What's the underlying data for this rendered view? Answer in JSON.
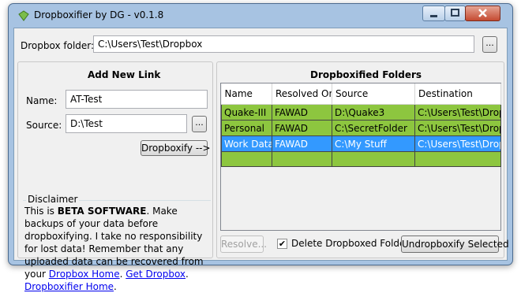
{
  "window": {
    "title": "Dropboxifier by DG - v0.1.8",
    "minimize": "–",
    "maximize": "▢",
    "close": "✕"
  },
  "folder": {
    "label": "Dropbox folder:",
    "value": "C:\\Users\\Test\\Dropbox",
    "browse": "..."
  },
  "add_link": {
    "title": "Add New Link",
    "name_label": "Name:",
    "name_value": "AT-Test",
    "source_label": "Source:",
    "source_value": "D:\\Test",
    "browse": "...",
    "dropboxify": "Dropboxify -->"
  },
  "disclaimer": {
    "legend": "Disclaimer",
    "t1": "This is ",
    "bold": "BETA SOFTWARE",
    "t2": ". Make backups of your data before dropboxifying. I take no responsibility for lost data! Remember that any uploaded data can be recovered from your ",
    "link1": "Dropbox Home",
    "t3": ". ",
    "link2": "Get Dropbox",
    "t4": ".",
    "link3": "Dropboxifier Home",
    "t5": "."
  },
  "folders": {
    "title": "Dropboxified Folders",
    "columns": [
      "Name",
      "Resolved On",
      "Source",
      "Destination"
    ],
    "rows": [
      {
        "name": "Quake-III",
        "resolved": "FAWAD",
        "source": "D:\\Quake3",
        "destination": "C:\\Users\\Test\\Dropb"
      },
      {
        "name": "Personal",
        "resolved": "FAWAD",
        "source": "C:\\SecretFolder",
        "destination": "C:\\Users\\Test\\Dropb"
      },
      {
        "name": "Work Data",
        "resolved": "FAWAD",
        "source": "C:\\My Stuff",
        "destination": "C:\\Users\\Test\\Dropb"
      }
    ],
    "resolve": "Resolve...",
    "delete_label": "Delete Dropboxed Folder",
    "delete_checked": "✔",
    "undropboxify": "Undropboxify Selected"
  }
}
